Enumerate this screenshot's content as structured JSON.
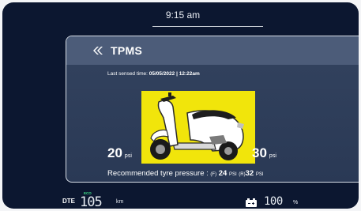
{
  "status": {
    "time": "9:15 am"
  },
  "header": {
    "title": "TPMS",
    "back_icon": "double-chevron-left-icon"
  },
  "tpms": {
    "last_sensed_label": "Last sensed time: ",
    "last_sensed_value": "05/05/2022 | 12:22am",
    "front_pressure": "20",
    "rear_pressure": "30",
    "unit": "psi",
    "recommended_label": "Recommended tyre pressure : ",
    "front_tag": "(F)",
    "front_recommended": "24",
    "rear_tag": "(R)",
    "rear_recommended": "32",
    "rec_unit": "PSI",
    "image_bg_color": "#f1e50b",
    "image_icon": "scooter-icon"
  },
  "bottom": {
    "dte_label": "DTE",
    "eco_label": "ECO",
    "dte_value": "105",
    "dte_unit": "km",
    "battery_value": "100",
    "battery_unit": "%",
    "battery_icon": "battery-icon"
  }
}
